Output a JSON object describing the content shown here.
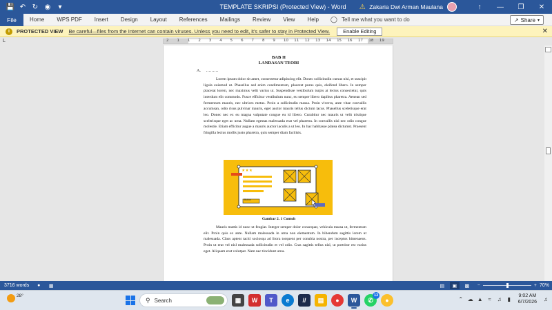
{
  "titlebar": {
    "title": "TEMPLATE SKRIPSI (Protected View)  -  Word",
    "username": "Zakaria Dwi Arman Maulana",
    "quick_access": [
      "save-icon",
      "undo-icon",
      "redo-icon",
      "autosave-icon",
      "customize-icon"
    ],
    "window_controls": {
      "ribbon_display": "↑",
      "minimize": "—",
      "restore": "❐",
      "close": "✕"
    }
  },
  "ribbon": {
    "file": "File",
    "tabs": [
      "Home",
      "WPS PDF",
      "Insert",
      "Design",
      "Layout",
      "References",
      "Mailings",
      "Review",
      "View",
      "Help"
    ],
    "tell_me": "Tell me what you want to do",
    "share": "Share"
  },
  "protected_view": {
    "label": "PROTECTED VIEW",
    "message": "Be careful—files from the Internet can contain viruses. Unless you need to edit, it's safer to stay in Protected View.",
    "button": "Enable Editing",
    "icon": "i"
  },
  "ruler": {
    "tab_marker": "L",
    "ticks": [
      "2",
      "1",
      "1",
      "2",
      "3",
      "4",
      "5",
      "6",
      "7",
      "8",
      "9",
      "10",
      "11",
      "12",
      "13",
      "14",
      "15",
      "16",
      "17",
      "18",
      "19"
    ]
  },
  "document": {
    "chapter": "BAB II",
    "chapter_title": "LANDASAN TEORI",
    "section_label": "A.",
    "section_text": "………",
    "paragraph1": "Lorem ipsum dolor sit amet, consectetur adipiscing elit. Donec sollicitudin cursus nisi, et suscipit ligula euismod ut. Phasellus sed enim condimentum, placerat purus quis, eleifend libero. In semper placerat lorem, nec maximus velit varius ut. Suspendisse vestibulum turpis at lectus consectetur, quis interdum elit commodo. Fusce efficitur vestibulum nunc, eu semper libero dapibus pharetra. Aenean sed fermentum mauris, nec ultrices metus. Proin a sollicitudin massa. Proin viverra, ante vitae convallis accumsan, odio risus pulvinar mauris, eget auctor mauris tellus dictum lacus. Phasellus scelerisque erat leo. Donec nec ex eu magna vulputate congue eu id libero. Curabitur nec mauris ut velit tristique scelerisque eget ac urna. Nullam egestas malesuada erat vel pharetra. In convallis nisi nec odio congue molestie. Etiam efficitur augue a mauris auctor iaculis a ut leo. In hac habitasse platea dictumst. Praesent fringilla lectus mollis justo pharetra, quis semper diam facilisis.",
    "figure_button_label": "Button",
    "figure_caption": "Gambar 2. 1 Contoh",
    "paragraph2": "Mauris mattis id nunc ut feugiat. Integer semper dolor consequat, vehicula massa ut, fermentum elit. Proin quis ex ante. Nullam malesuada in urna non elementum. In bibendum sagittis lorem ut malesuada. Class aptent taciti sociosqu ad litora torquent per conubia nostra, per inceptos himenaeos. Proin ut erat vel nisl malesuada sollicitudin et vel odio. Cras sagittis tellus nisl, ut porttitor est varius eget. Aliquam erat volutpat. Nam nec tincidunt urna."
  },
  "statusbar": {
    "words": "3716 words",
    "zoom": "70%",
    "zoom_level": 0.7,
    "view_icons": [
      "read-mode-icon",
      "print-layout-icon",
      "web-layout-icon"
    ]
  },
  "taskbar": {
    "temperature": "28°",
    "search_placeholder": "Search",
    "time": "9:02 AM",
    "date": "6/7/2026",
    "whatsapp_badge": "13",
    "apps": [
      "file-explorer-icon",
      "wps-icon",
      "teams-icon",
      "edge-icon",
      "slash-app-icon",
      "folder-icon",
      "chrome-icon",
      "word-icon",
      "whatsapp-icon",
      "chrome-alt-icon"
    ]
  },
  "colors": {
    "word_blue": "#2b579a",
    "protected_yellow": "#fdf3bc",
    "figure_yellow": "#f7bd0c"
  }
}
